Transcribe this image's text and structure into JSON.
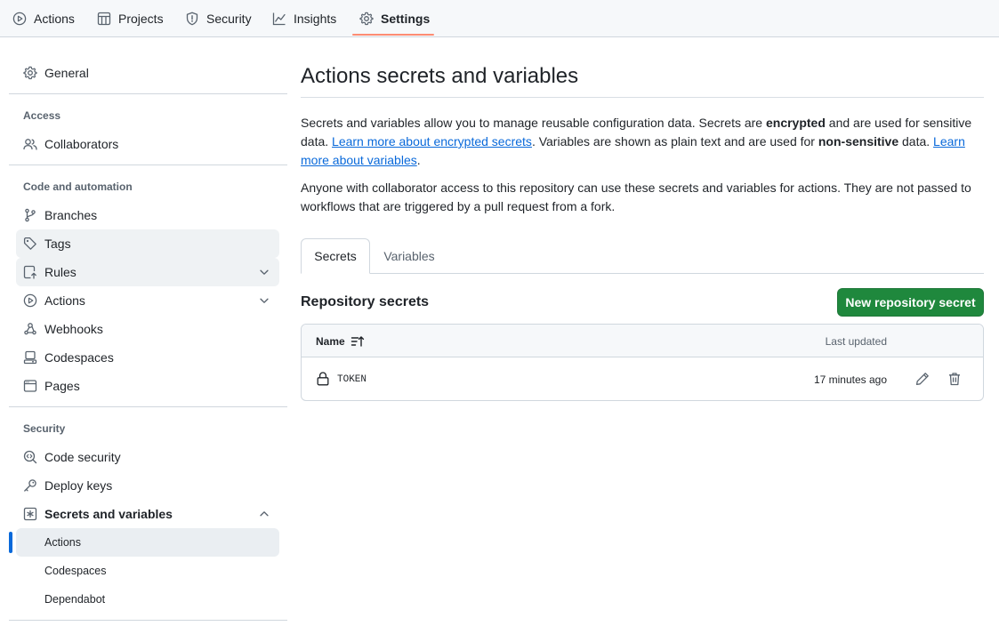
{
  "topnav": {
    "actions": "Actions",
    "projects": "Projects",
    "security": "Security",
    "insights": "Insights",
    "settings": "Settings"
  },
  "sidebar": {
    "general": "General",
    "access_heading": "Access",
    "collaborators": "Collaborators",
    "code_heading": "Code and automation",
    "branches": "Branches",
    "tags": "Tags",
    "rules": "Rules",
    "actions": "Actions",
    "webhooks": "Webhooks",
    "codespaces": "Codespaces",
    "pages": "Pages",
    "security_heading": "Security",
    "code_security": "Code security",
    "deploy_keys": "Deploy keys",
    "secrets_and_variables": "Secrets and variables",
    "sub_actions": "Actions",
    "sub_codespaces": "Codespaces",
    "sub_dependabot": "Dependabot"
  },
  "main": {
    "title": "Actions secrets and variables",
    "p1_a": "Secrets and variables allow you to manage reusable configuration data. Secrets are ",
    "p1_b": "encrypted",
    "p1_c": " and are used for sensitive data. ",
    "p1_link1": "Learn more about encrypted secrets",
    "p1_d": ". Variables are shown as plain text and are used for ",
    "p1_e": "non-sensitive",
    "p1_f": " data. ",
    "p1_link2": "Learn more about variables",
    "p1_g": ".",
    "p2": "Anyone with collaborator access to this repository can use these secrets and variables for actions. They are not passed to workflows that are triggered by a pull request from a fork.",
    "tab_secrets": "Secrets",
    "tab_variables": "Variables",
    "section_title": "Repository secrets",
    "new_button": "New repository secret",
    "col_name": "Name",
    "col_updated": "Last updated",
    "secrets": [
      {
        "name": "TOKEN",
        "updated": "17 minutes ago"
      }
    ]
  },
  "colors": {
    "accent": "#0969da",
    "primary_button": "#1f883d",
    "active_tab_underline": "#fd8c73"
  }
}
